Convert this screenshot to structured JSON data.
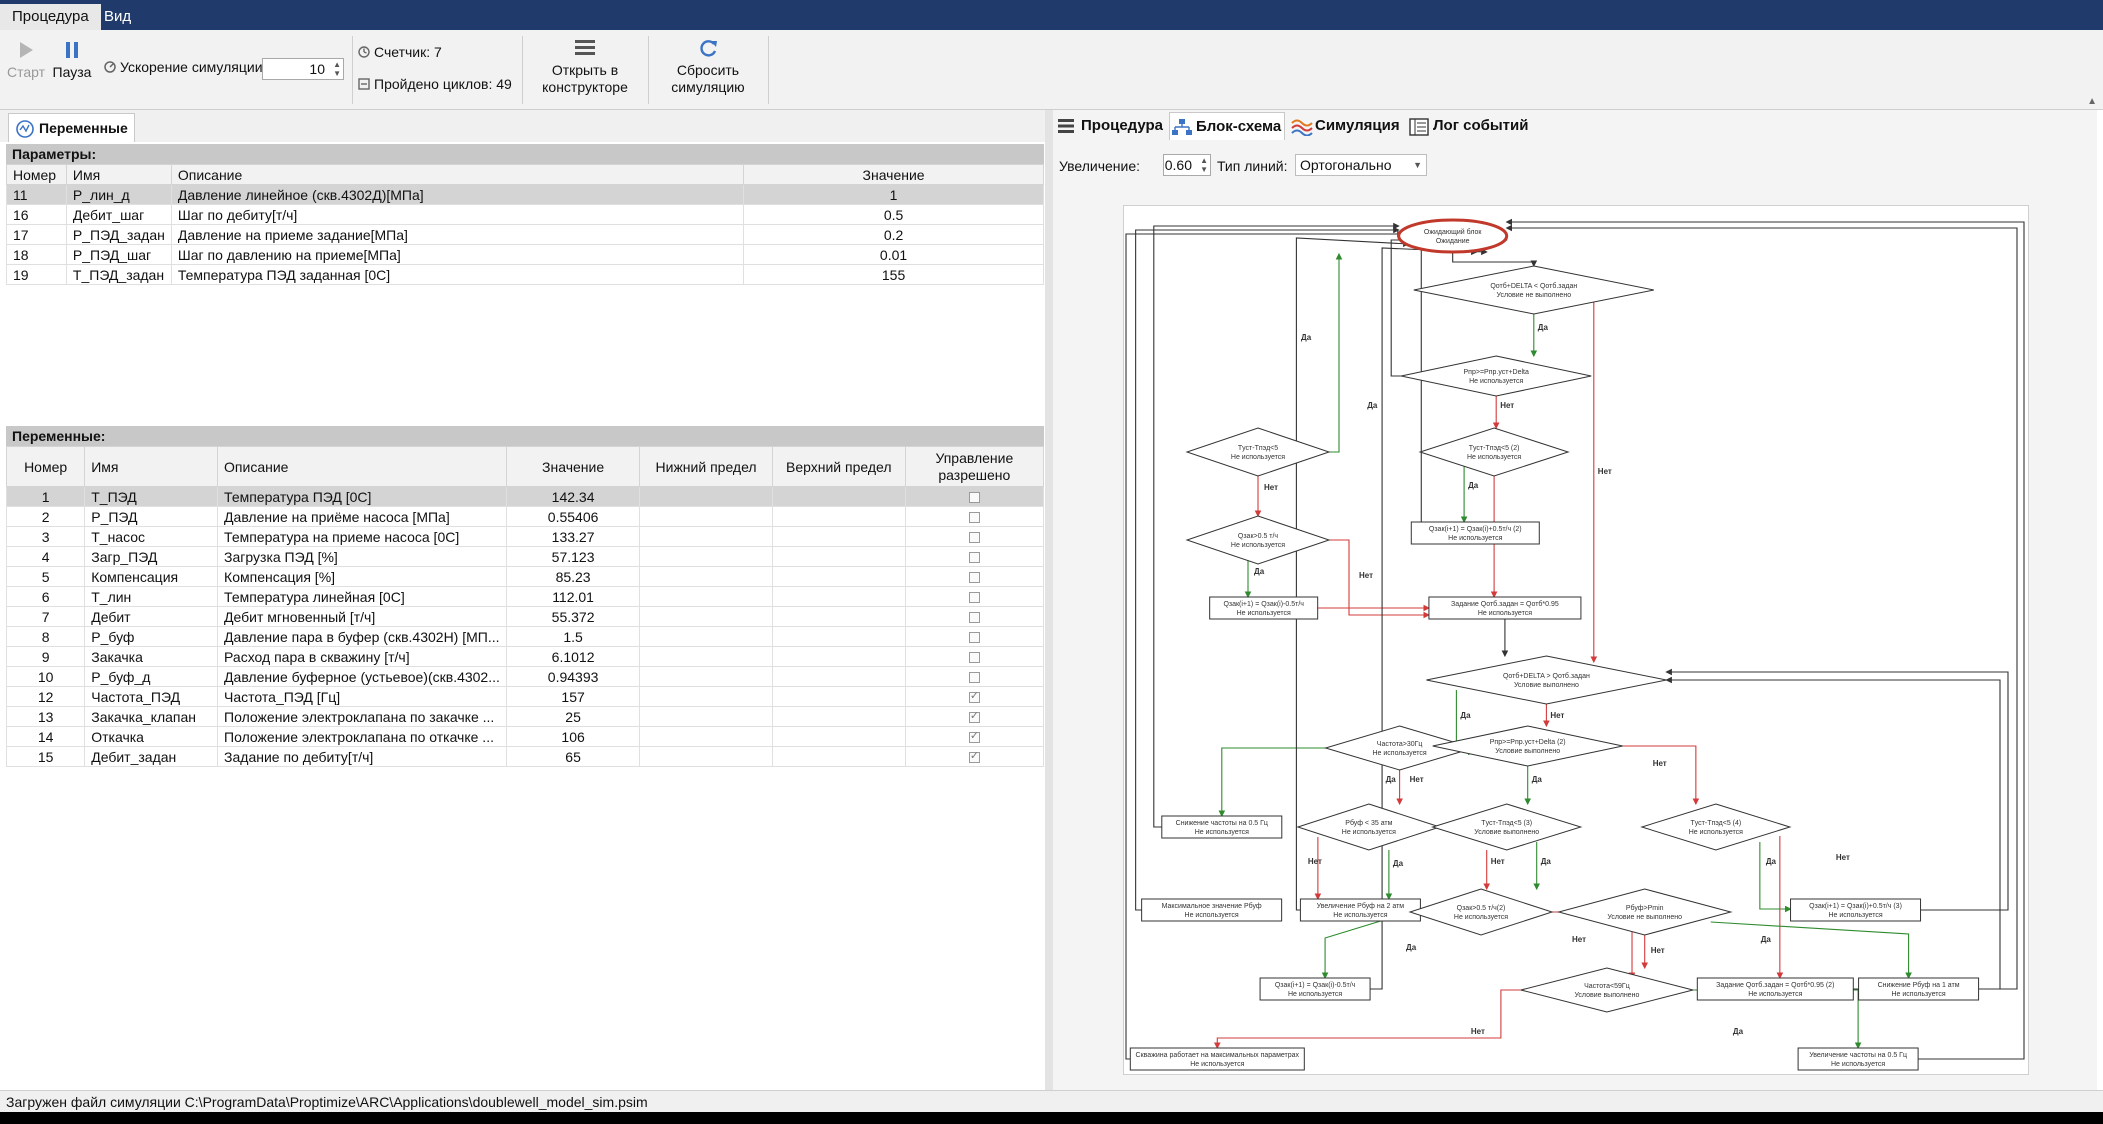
{
  "menu": {
    "procedure": "Процедура",
    "view": "Вид"
  },
  "toolbar": {
    "start": "Старт",
    "pause": "Пауза",
    "speed_label": "Ускорение симуляции:",
    "speed_value": "10",
    "counter": "Счетчик: 7",
    "cycles": "Пройдено циклов: 49",
    "open_constructor": [
      "Открыть в",
      "конструкторе"
    ],
    "reset_sim": [
      "Сбросить",
      "симуляцию"
    ]
  },
  "left_tab": "Переменные",
  "params": {
    "title": "Параметры:",
    "headers": [
      "Номер",
      "Имя",
      "Описание",
      "Значение"
    ],
    "rows": [
      [
        "11",
        "P_лин_д",
        "Давление линейное (скв.4302Д)[МПа]",
        "1"
      ],
      [
        "16",
        "Дебит_шаг",
        "Шаг по дебиту[т/ч]",
        "0.5"
      ],
      [
        "17",
        "P_ПЭД_задан",
        "Давление на приеме задание[МПа]",
        "0.2"
      ],
      [
        "18",
        "P_ПЭД_шаг",
        "Шаг по давлению на приеме[МПа]",
        "0.01"
      ],
      [
        "19",
        "T_ПЭД_задан",
        "Температура ПЭД заданная [0С]",
        "155"
      ]
    ]
  },
  "vars": {
    "title": "Переменные:",
    "headers": [
      "Номер",
      "Имя",
      "Описание",
      "Значение",
      "Нижний предел",
      "Верхний предел",
      "Управление разрешено"
    ],
    "rows": [
      [
        "1",
        "T_ПЭД",
        "Температура ПЭД [0С]",
        "142.34",
        false
      ],
      [
        "2",
        "P_ПЭД",
        "Давление на приёме насоса [МПа]",
        "0.55406",
        false
      ],
      [
        "3",
        "T_насос",
        "Температура на приеме насоса [0С]",
        "133.27",
        false
      ],
      [
        "4",
        "Загр_ПЭД",
        "Загрузка ПЭД [%]",
        "57.123",
        false
      ],
      [
        "5",
        "Компенсация",
        "Компенсация [%]",
        "85.23",
        false
      ],
      [
        "6",
        "T_лин",
        "Температура линейная [0С]",
        "112.01",
        false
      ],
      [
        "7",
        "Дебит",
        "Дебит мгновенный [т/ч]",
        "55.372",
        false
      ],
      [
        "8",
        "P_буф",
        "Давление пара в буфер (скв.4302Н) [МП...",
        "1.5",
        false
      ],
      [
        "9",
        "Закачка",
        "Расход пара в скважину [т/ч]",
        "6.1012",
        false
      ],
      [
        "10",
        "P_буф_д",
        "Давление буферное (устьевое)(скв.4302...",
        "0.94393",
        false
      ],
      [
        "12",
        "Частота_ПЭД",
        "Частота_ПЭД [Гц]",
        "157",
        true
      ],
      [
        "13",
        "Закачка_клапан",
        "Положение электроклапана по закачке ...",
        "25",
        true
      ],
      [
        "14",
        "Откачка",
        "Положение электроклапана по откачке ...",
        "106",
        true
      ],
      [
        "15",
        "Дебит_задан",
        "Задание по дебиту[т/ч]",
        "65",
        true
      ]
    ]
  },
  "right_tabs": [
    "Процедура",
    "Блок-схема",
    "Симуляция",
    "Лог событий"
  ],
  "zoom": {
    "label": "Увеличение:",
    "value": "0.60",
    "line_type_label": "Тип линий:",
    "line_type": "Ортогонально"
  },
  "flow": {
    "start": [
      "Ожидающий блок",
      "Ожидание"
    ],
    "d1": [
      "Qотб+DELTA < Qотб.задан",
      "Условие не выполнено"
    ],
    "d2": [
      "Pпр>=Pпр.уст+Delta",
      "Не используется"
    ],
    "d3": [
      "Tуст-Tпэд<5",
      "Не используется"
    ],
    "d4": [
      "Tуст-Tпэд<5 (2)",
      "Не используется"
    ],
    "d5": [
      "Qзак>0.5 т/ч",
      "Не используется"
    ],
    "b1": [
      "Qзак(i+1) = Qзак(i)+0.5т/ч (2)",
      "Не используется"
    ],
    "b2": [
      "Qзак(i+1) = Qзак(i)-0.5т/ч",
      "Не используется"
    ],
    "b3": [
      "Задание Qотб.задан = Qотб*0.95",
      "Не используется"
    ],
    "d6": [
      "Qотб+DELTA > Qотб.задан",
      "Условие выполнено"
    ],
    "d7": [
      "Частота>30Гц",
      "Не используется"
    ],
    "d8": [
      "Pпр>=Pпр.уст+Delta (2)",
      "Условие выполнено"
    ],
    "b4": [
      "Снижение частоты на 0.5 Гц",
      "Не используется"
    ],
    "d9": [
      "Pбуф < 35 атм",
      "Не используется"
    ],
    "d10": [
      "Tуст-Tпэд<5 (3)",
      "Условие выполнено"
    ],
    "d11": [
      "Tуст-Tпэд<5 (4)",
      "Не используется"
    ],
    "b5": [
      "Максимальное значение Pбуф",
      "Не используется"
    ],
    "b6": [
      "Увеличение Pбуф на 2 атм",
      "Не используется"
    ],
    "d12": [
      "Qзак>0.5 т/ч(2)",
      "Не используется"
    ],
    "d13": [
      "Pбуф>Pmin",
      "Условие не выполнено"
    ],
    "b7": [
      "Qзак(i+1) = Qзак(i)+0.5т/ч (3)",
      "Не используется"
    ],
    "b8": [
      "Qзак(i+1) = Qзак(i)-0.5т/ч",
      "Не используется"
    ],
    "b9": [
      "Задание Qотб.задан = Qотб*0.95 (2)",
      "Не используется"
    ],
    "b10": [
      "Снижение Pбуф на 1 атм",
      "Не используется"
    ],
    "d14": [
      "Частота<59Гц",
      "Условие выполнено"
    ],
    "b11": [
      "Скважина работает на максимальных параметрах",
      "Не используется"
    ],
    "b12": [
      "Увеличение частоты на 0.5 Гц",
      "Не используется"
    ],
    "yes": "Да",
    "no": "Нет"
  },
  "status": "Загружен файл симуляции C:\\ProgramData\\Proptimize\\ARC\\Applications\\doublewell_model_sim.psim",
  "colors": {
    "menubar": "#1f3a6b",
    "yes_edge": "#2e8b2e",
    "no_edge": "#d33b3b",
    "edge": "#333333",
    "active_node": "#c0392b"
  }
}
